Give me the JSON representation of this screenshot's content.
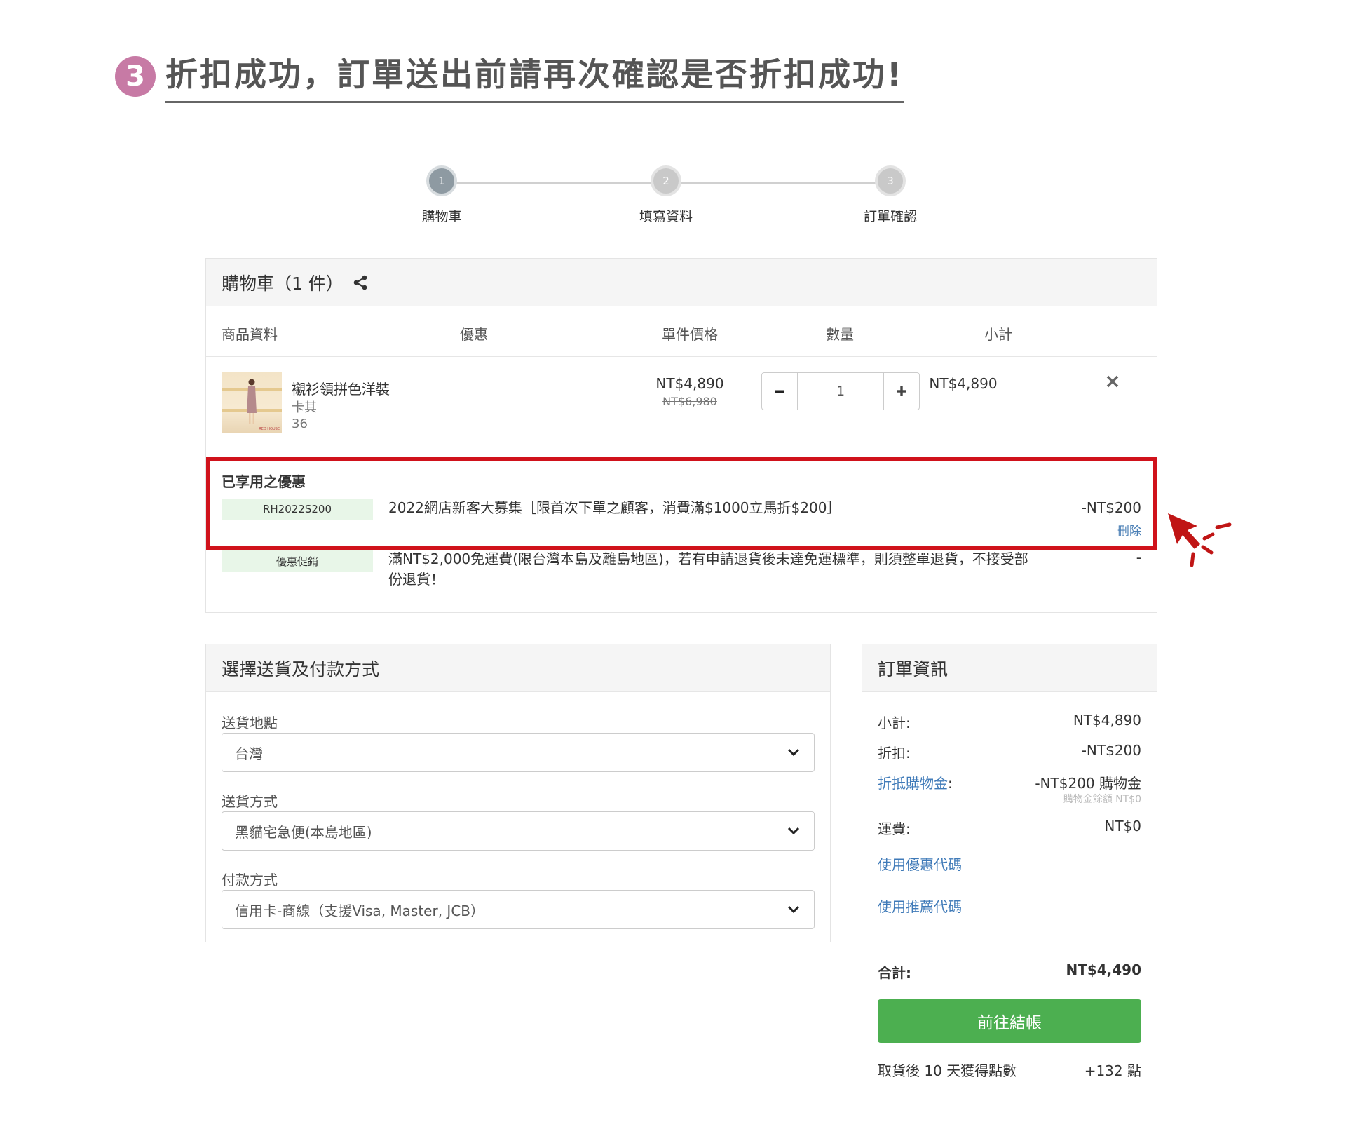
{
  "title": {
    "step_number": "3",
    "text": "折扣成功，訂單送出前請再次確認是否折扣成功!"
  },
  "stepper": [
    {
      "num": "1",
      "label": "購物車"
    },
    {
      "num": "2",
      "label": "填寫資料"
    },
    {
      "num": "3",
      "label": "訂單確認"
    }
  ],
  "cart": {
    "heading": "購物車（1 件）",
    "columns": {
      "product": "商品資料",
      "promo": "優惠",
      "unit_price": "單件價格",
      "qty": "數量",
      "subtotal": "小計"
    },
    "item": {
      "name": "襯衫領拼色洋裝",
      "color": "卡其",
      "size": "36",
      "thumb_brand": "RED HOUSE",
      "price": "NT$4,890",
      "original_price": "NT$6,980",
      "quantity": "1",
      "subtotal": "NT$4,890"
    },
    "applied_title": "已享用之優惠",
    "coupon": {
      "code": "RH2022S200",
      "description": "2022網店新客大募集［限首次下單之顧客，消費滿$1000立馬折$200］",
      "amount": "-NT$200",
      "delete_label": "刪除"
    },
    "promotion": {
      "tag": "優惠促銷",
      "description_line1": "滿NT$2,000免運費(限台灣本島及離島地區)，若有申請退貨後未達免運標準，則須整單退貨，不接受部",
      "description_line2": "份退貨！",
      "amount": "-"
    }
  },
  "shipping": {
    "heading": "選擇送貨及付款方式",
    "location_label": "送貨地點",
    "location_value": "台灣",
    "method_label": "送貨方式",
    "method_value": "黑貓宅急便(本島地區)",
    "payment_label": "付款方式",
    "payment_value": "信用卡-商線（支援Visa, Master, JCB）"
  },
  "order": {
    "heading": "訂單資訊",
    "subtotal_label": "小計:",
    "subtotal_value": "NT$4,890",
    "discount_label": "折扣:",
    "discount_value": "-NT$200",
    "credit_label": "折抵購物金",
    "credit_colon": ":",
    "credit_value": "-NT$200 購物金",
    "credit_note": "購物金餘額 NT$0",
    "shipping_label": "運費:",
    "shipping_value": "NT$0",
    "coupon_link": "使用優惠代碼",
    "referral_link": "使用推薦代碼",
    "total_label": "合計:",
    "total_value": "NT$4,490",
    "checkout_label": "前往結帳",
    "points_label": "取貨後 10 天獲得點數",
    "points_value": "+132 點"
  },
  "colors": {
    "step_badge": "#c77aa5",
    "highlight_border": "#d0121b",
    "checkout_button": "#4caf50",
    "link": "#3f7ab8",
    "code_tag_bg": "#e8f6e8"
  }
}
